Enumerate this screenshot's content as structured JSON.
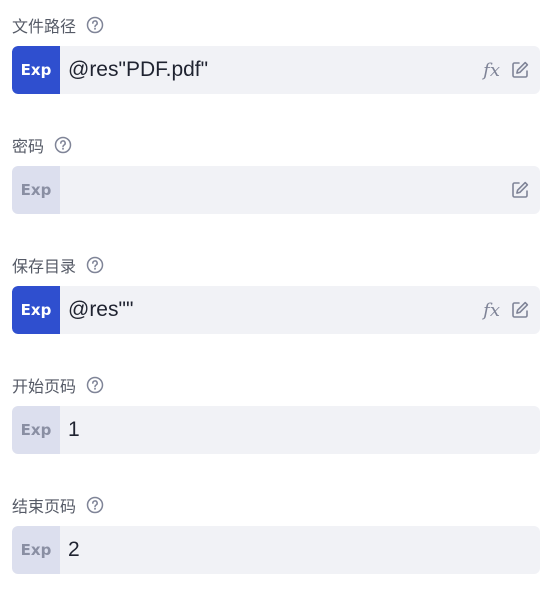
{
  "fields": [
    {
      "label": "文件路径",
      "exp": "Exp",
      "exp_active": true,
      "value": "@res\"PDF.pdf\"",
      "fx": "fx",
      "has_fx": true
    },
    {
      "label": "密码",
      "exp": "Exp",
      "exp_active": false,
      "value": "",
      "fx": "",
      "has_fx": false
    },
    {
      "label": "保存目录",
      "exp": "Exp",
      "exp_active": true,
      "value": "@res\"\"",
      "fx": "fx",
      "has_fx": true
    },
    {
      "label": "开始页码",
      "exp": "Exp",
      "exp_active": false,
      "value": "1",
      "fx": "",
      "has_fx": false
    },
    {
      "label": "结束页码",
      "exp": "Exp",
      "exp_active": false,
      "value": "2",
      "fx": "",
      "has_fx": false
    }
  ],
  "colors": {
    "accent": "#2f4fcf",
    "exp_inactive_bg": "#dcdfee",
    "input_bg": "#f1f2f6",
    "label": "#555a66",
    "icon": "#7f8497"
  },
  "icons": {
    "help": "question-circle-icon",
    "fx": "function-fx-icon",
    "edit": "edit-pencil-icon"
  }
}
